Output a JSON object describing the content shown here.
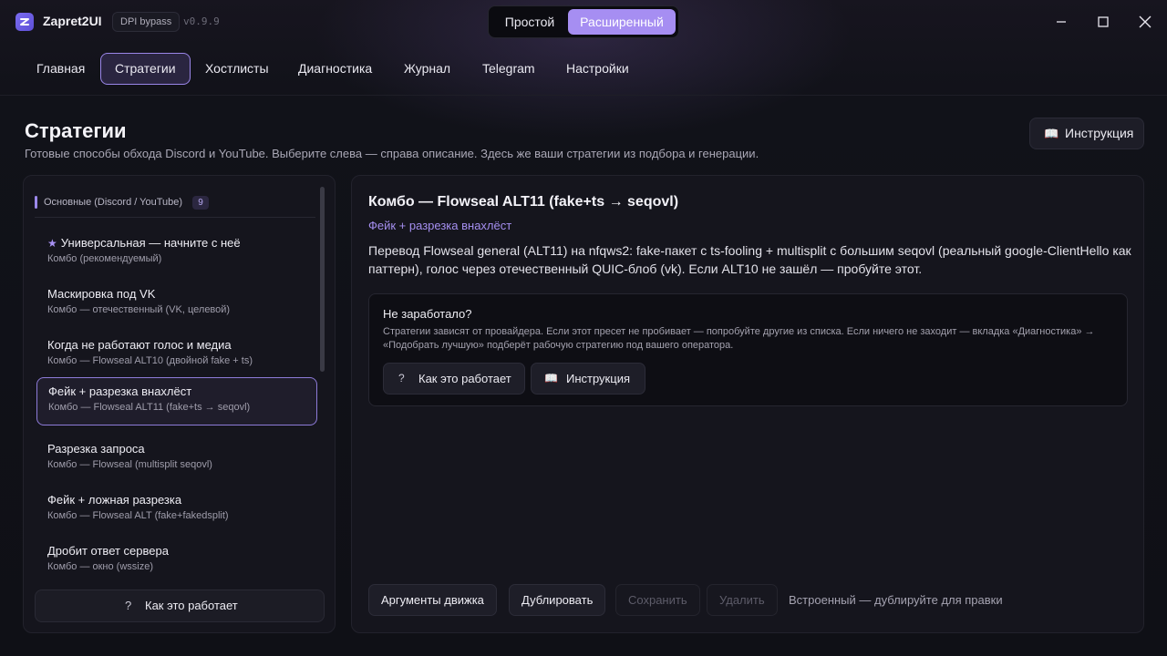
{
  "app": {
    "title": "Zapret2UI",
    "badge": "DPI bypass",
    "version": "v0.9.9"
  },
  "mode": {
    "simple": "Простой",
    "advanced": "Расширенный",
    "active": "advanced"
  },
  "nav": {
    "tabs": [
      {
        "label": "Главная"
      },
      {
        "label": "Стратегии"
      },
      {
        "label": "Хостлисты"
      },
      {
        "label": "Диагностика"
      },
      {
        "label": "Журнал"
      },
      {
        "label": "Telegram"
      },
      {
        "label": "Настройки"
      }
    ],
    "active": "Стратегии"
  },
  "page": {
    "title": "Стратегии",
    "subtitle": "Готовые способы обхода Discord и YouTube. Выберите слева — справа описание. Здесь же ваши стратегии из подбора и генерации.",
    "guide_button": "Инструкция"
  },
  "sidebar": {
    "group": {
      "label": "Основные (Discord / YouTube)",
      "count": "9"
    },
    "items": [
      {
        "title": "Универсальная — начните с неё",
        "sub": "Комбо (рекомендуемый)"
      },
      {
        "title": "Маскировка под VK",
        "sub": "Комбо — отечественный (VK, целевой)"
      },
      {
        "title": "Когда не работают голос и медиа",
        "sub": "Комбо — Flowseal ALT10 (двойной fake + ts)"
      },
      {
        "title": "Фейк + разрезка внахлёст",
        "sub": "Комбо — Flowseal ALT11 (fake+ts → seqovl)"
      },
      {
        "title": "Разрезка запроса",
        "sub": "Комбо — Flowseal (multisplit seqovl)"
      },
      {
        "title": "Фейк + ложная разрезка",
        "sub": "Комбо — Flowseal ALT (fake+fakedsplit)"
      },
      {
        "title": "Дробит ответ сервера",
        "sub": "Комбо — окно (wssize)"
      }
    ],
    "selected_index": 3,
    "how_button": "Как это работает"
  },
  "detail": {
    "title": "Комбо — Flowseal ALT11 (fake+ts → seqovl)",
    "tag": "Фейк + разрезка внахлёст",
    "description": "Перевод Flowseal general (ALT11) на nfqws2: fake-пакет с ts-fooling + multisplit с большим seqovl (реальный google-ClientHello как паттерн), голос через отечественный QUIC-блоб (vk). Если ALT10 не зашёл — пробуйте этот.",
    "help": {
      "title": "Не заработало?",
      "text": "Стратегии зависят от провайдера. Если этот пресет не пробивает — попробуйте другие из списка. Если ничего не заходит — вкладка «Диагностика» → «Подобрать лучшую» подберёт рабочую стратегию под вашего оператора.",
      "how_button": "Как это работает",
      "guide_button": "Инструкция"
    },
    "actions": {
      "args": "Аргументы движка",
      "duplicate": "Дублировать",
      "save": "Сохранить",
      "delete": "Удалить",
      "note": "Встроенный — дублируйте для правки"
    }
  },
  "colors": {
    "accent": "#a68ef2",
    "background": "#0f1016",
    "panel": "#15151d"
  },
  "icons": {
    "star": "★",
    "book": "📖",
    "question": "?"
  }
}
